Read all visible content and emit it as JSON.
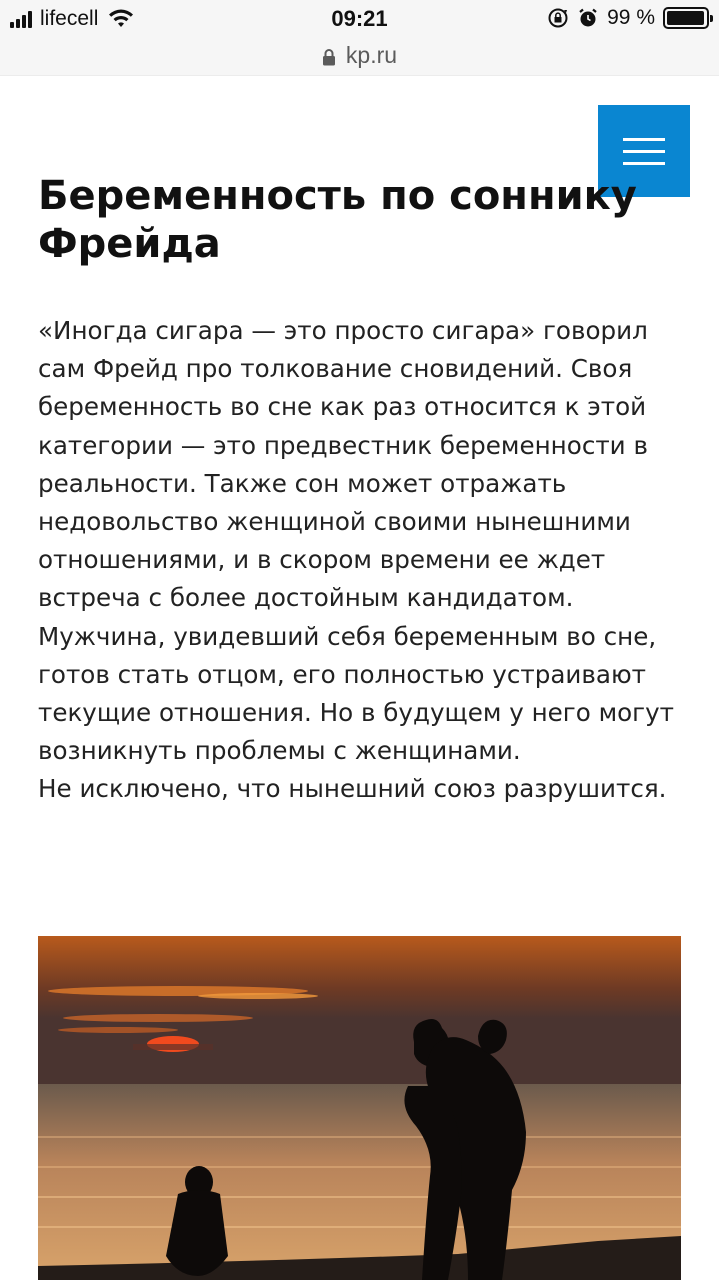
{
  "status_bar": {
    "carrier": "lifecell",
    "time": "09:21",
    "battery": "99 %"
  },
  "browser": {
    "url": "kp.ru"
  },
  "icons": {
    "signal": "signal-icon",
    "wifi": "wifi-icon",
    "rotation_lock": "rotation-lock-icon",
    "alarm": "alarm-icon",
    "battery": "battery-icon",
    "lock": "lock-icon",
    "menu": "hamburger-menu-icon"
  },
  "colors": {
    "menu_button": "#0a86d1"
  },
  "article": {
    "title": "Беременность по соннику Фрейда",
    "paragraphs": [
      "«Иногда сигара — это просто сигара» говорил сам Фрейд про толкование сновидений. Своя беременность во сне как раз относится к этой категории — это предвестник беременности в реальности. Также сон может отражать недовольство женщиной своими нынешними отношениями, и в скором времени ее ждет встреча с более достойным кандидатом.",
      "Мужчина, увидевший себя беременным во сне, готов стать отцом, его полностью устраивают текущие отношения. Но в будущем у него могут возникнуть проблемы с женщинами.",
      "Не исключено, что нынешний союз разрушится."
    ]
  }
}
